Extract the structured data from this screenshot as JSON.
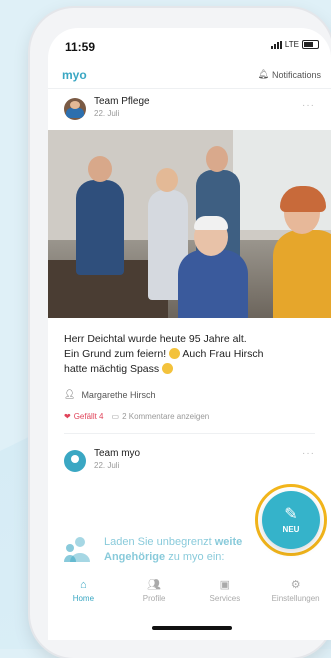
{
  "status": {
    "time": "11:59",
    "network": "LTE"
  },
  "app": {
    "logo": "myo",
    "notifications_label": "Notifications"
  },
  "post1": {
    "author": "Team Pflege",
    "date": "22. Juli",
    "more": "···",
    "caption_lines": [
      "Herr Deichtal wurde heute 95 Jahre alt.",
      "Ein Grund zum feiern!",
      "Auch Frau Hirsch",
      "hatte mächtig Spass"
    ],
    "tagged_person": "Margarethe Hirsch",
    "likes_label": "Gefällt 4",
    "comments_label": "2 Kommentare anzeigen"
  },
  "post2": {
    "author": "Team myo",
    "date": "22. Juli",
    "more": "···"
  },
  "invite": {
    "text_prefix": "Laden Sie unbegrenzt",
    "text_bold": "weite",
    "line2_bold": "Angehörige",
    "line2_suffix": "zu myo ein:"
  },
  "fab": {
    "label": "NEU",
    "icon": "pencil-plus-icon"
  },
  "tabs": [
    {
      "label": "Home",
      "icon": "home-icon"
    },
    {
      "label": "Profile",
      "icon": "people-icon"
    },
    {
      "label": "Services",
      "icon": "services-icon"
    },
    {
      "label": "Einstellungen",
      "icon": "gear-icon"
    }
  ],
  "colors": {
    "accent": "#3aa7c3",
    "highlight_ring": "#f2b51b",
    "like": "#e0445a"
  }
}
